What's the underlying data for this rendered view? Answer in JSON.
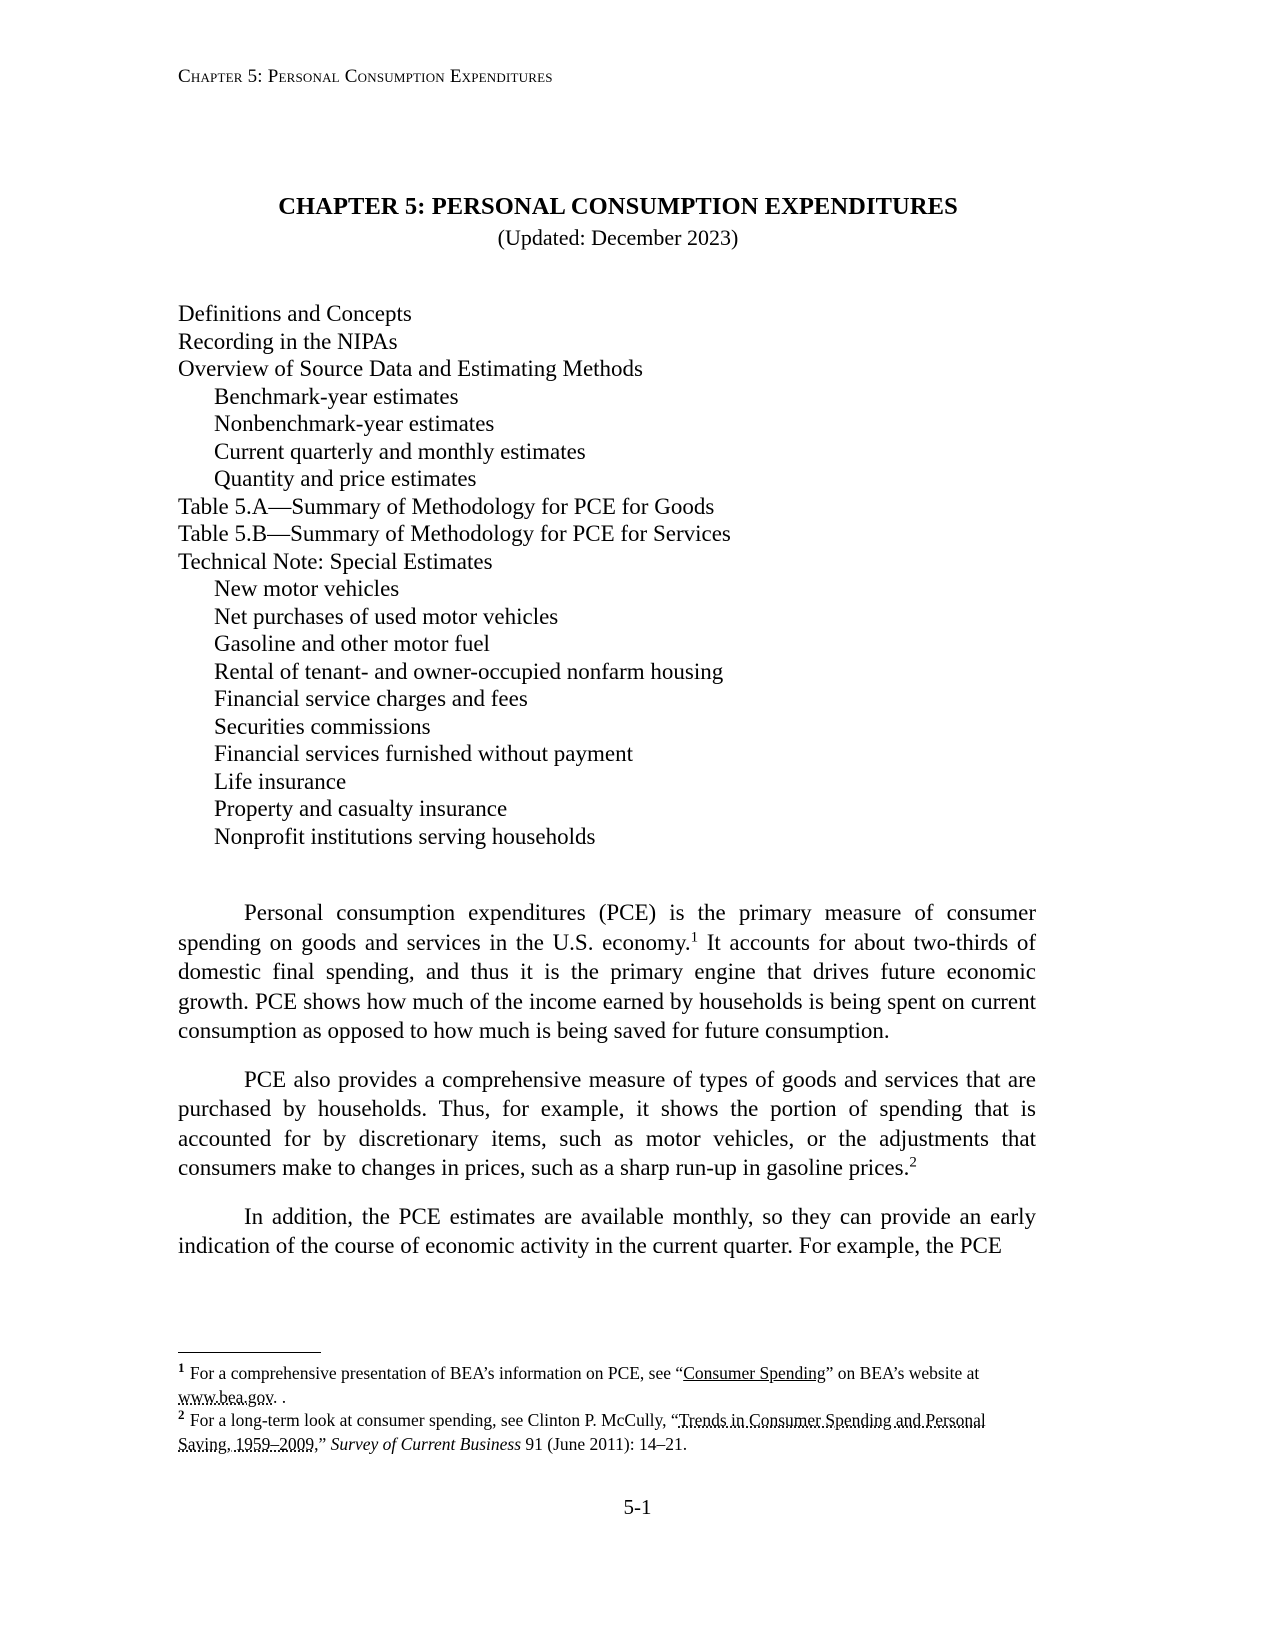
{
  "header": {
    "running_header": "Chapter 5: Personal Consumption Expenditures"
  },
  "title_block": {
    "title": "CHAPTER 5: PERSONAL CONSUMPTION EXPENDITURES",
    "subtitle": "(Updated: December 2023)"
  },
  "toc": {
    "items": [
      {
        "label": "Definitions and Concepts",
        "level": 1
      },
      {
        "label": "Recording in the NIPAs",
        "level": 1
      },
      {
        "label": "Overview of Source Data and Estimating Methods",
        "level": 1
      },
      {
        "label": "Benchmark-year estimates",
        "level": 2
      },
      {
        "label": "Nonbenchmark-year estimates",
        "level": 2
      },
      {
        "label": "Current quarterly and monthly estimates",
        "level": 2
      },
      {
        "label": "Quantity and price estimates",
        "level": 2
      },
      {
        "label": "Table 5.A—Summary of Methodology for PCE for Goods",
        "level": 1
      },
      {
        "label": "Table 5.B—Summary of Methodology for PCE for Services",
        "level": 1
      },
      {
        "label": "Technical Note: Special Estimates",
        "level": 1
      },
      {
        "label": "New motor vehicles",
        "level": 2
      },
      {
        "label": "Net purchases of used motor vehicles",
        "level": 2
      },
      {
        "label": "Gasoline and other motor fuel",
        "level": 2
      },
      {
        "label": "Rental of tenant- and owner-occupied nonfarm housing",
        "level": 2
      },
      {
        "label": "Financial service charges and fees",
        "level": 2
      },
      {
        "label": "Securities commissions",
        "level": 2
      },
      {
        "label": "Financial services furnished without payment",
        "level": 2
      },
      {
        "label": "Life insurance",
        "level": 2
      },
      {
        "label": "Property and casualty insurance",
        "level": 2
      },
      {
        "label": "Nonprofit institutions serving households",
        "level": 2
      }
    ]
  },
  "body": {
    "paragraph_1_part_1": "Personal consumption expenditures (PCE) is the primary measure of consumer spending on goods and services in the U.S. economy.",
    "paragraph_1_marker": "1",
    "paragraph_1_part_2": " It accounts for about two-thirds of domestic final spending, and thus it is the primary engine that drives future economic growth. PCE shows how much of the income earned by households is being spent on current consumption as opposed to how much is being saved for future consumption.",
    "paragraph_2_part_1": "PCE also provides a comprehensive measure of types of goods and services that are purchased by households. Thus, for example, it shows the portion of spending that is accounted for by discretionary items, such as motor vehicles, or the adjustments that consumers make to changes in prices, such as a sharp run-up in gasoline prices.",
    "paragraph_2_marker": "2",
    "paragraph_3": "In addition, the PCE estimates are available monthly, so they can provide an early indication of the course of economic activity in the current quarter. For example, the PCE"
  },
  "footnotes": {
    "note_1": {
      "marker": "1",
      "text_before_link": " For a comprehensive presentation of BEA’s information on PCE, see “",
      "link_text": "Consumer Spending",
      "text_between": "” on BEA’s website at ",
      "url_text": "www.bea.gov",
      "text_after": ". ."
    },
    "note_2": {
      "marker": "2",
      "text_before_link": " For a long-term look at consumer spending, see Clinton P. McCully, “",
      "link_text": "Trends in Consumer Spending and Personal Saving, 1959–2009",
      "text_between": ",” ",
      "italic_text": "Survey of Current Business",
      "text_after": " 91 (June 2011): 14–21."
    }
  },
  "footer": {
    "page_number": "5-1"
  }
}
